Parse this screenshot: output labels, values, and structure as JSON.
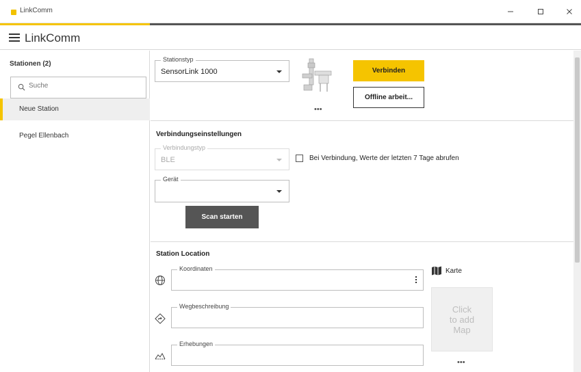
{
  "window": {
    "title": "LinkComm"
  },
  "app": {
    "title": "LinkComm"
  },
  "sidebar": {
    "header": "Stationen (2)",
    "search_placeholder": "Suche",
    "items": [
      {
        "label": "Neue Station",
        "active": true
      },
      {
        "label": "Pegel Ellenbach",
        "active": false
      }
    ]
  },
  "station": {
    "type_label": "Stationstyp",
    "type_value": "SensorLink 1000",
    "connect_label": "Verbinden",
    "offline_label": "Offline arbeit...",
    "more": "•••"
  },
  "connection": {
    "title": "Verbindungseinstellungen",
    "type_label": "Verbindungstyp",
    "type_value": "BLE",
    "checkbox_label": "Bei Verbindung, Werte der letzten 7 Tage abrufen",
    "device_label": "Gerät",
    "device_value": "",
    "scan_label": "Scan starten"
  },
  "location": {
    "title": "Station Location",
    "coordinates_label": "Koordinaten",
    "coordinates_value": "",
    "directions_label": "Wegbeschreibung",
    "directions_value": "",
    "elevation_label": "Erhebungen",
    "elevation_value": "",
    "map_label": "Karte",
    "map_placeholder_line1": "Click",
    "map_placeholder_line2": "to add",
    "map_placeholder_line3": "Map",
    "more": "•••"
  },
  "colors": {
    "accent": "#f5c400",
    "dark_button": "#555555"
  }
}
